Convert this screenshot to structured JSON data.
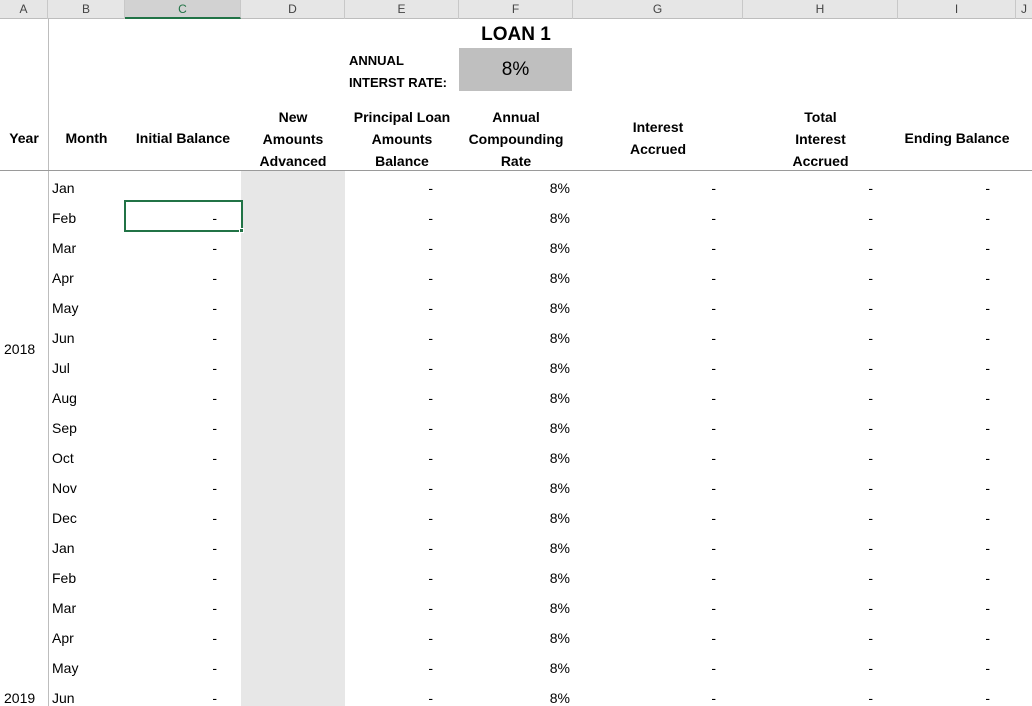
{
  "columns": [
    "A",
    "B",
    "C",
    "D",
    "E",
    "F",
    "G",
    "H",
    "I",
    "J"
  ],
  "selected_column": "C",
  "loan_title": "LOAN 1",
  "rate_label_line1": "ANNUAL",
  "rate_label_line2": "INTERST RATE:",
  "annual_rate": "8%",
  "headers": {
    "year": "Year",
    "month": "Month",
    "initial_balance": "Initial Balance",
    "new_amounts": [
      "New",
      "Amounts",
      "Advanced"
    ],
    "principal": [
      "Principal Loan",
      "Amounts",
      "Balance"
    ],
    "compounding": [
      "Annual",
      "Compounding",
      "Rate"
    ],
    "interest": [
      "Interest",
      "Accrued"
    ],
    "total_interest": [
      "Total",
      "Interest",
      "Accrued"
    ],
    "ending_balance": "Ending Balance"
  },
  "years": [
    "2018",
    "2019"
  ],
  "rows": [
    {
      "month": "Jan",
      "initial": "",
      "principal": "-",
      "rate": "8%",
      "interest": "-",
      "total": "-",
      "ending": "-"
    },
    {
      "month": "Feb",
      "initial": "-",
      "principal": "-",
      "rate": "8%",
      "interest": "-",
      "total": "-",
      "ending": "-"
    },
    {
      "month": "Mar",
      "initial": "-",
      "principal": "-",
      "rate": "8%",
      "interest": "-",
      "total": "-",
      "ending": "-"
    },
    {
      "month": "Apr",
      "initial": "-",
      "principal": "-",
      "rate": "8%",
      "interest": "-",
      "total": "-",
      "ending": "-"
    },
    {
      "month": "May",
      "initial": "-",
      "principal": "-",
      "rate": "8%",
      "interest": "-",
      "total": "-",
      "ending": "-"
    },
    {
      "month": "Jun",
      "initial": "-",
      "principal": "-",
      "rate": "8%",
      "interest": "-",
      "total": "-",
      "ending": "-"
    },
    {
      "month": "Jul",
      "initial": "-",
      "principal": "-",
      "rate": "8%",
      "interest": "-",
      "total": "-",
      "ending": "-"
    },
    {
      "month": "Aug",
      "initial": "-",
      "principal": "-",
      "rate": "8%",
      "interest": "-",
      "total": "-",
      "ending": "-"
    },
    {
      "month": "Sep",
      "initial": "-",
      "principal": "-",
      "rate": "8%",
      "interest": "-",
      "total": "-",
      "ending": "-"
    },
    {
      "month": "Oct",
      "initial": "-",
      "principal": "-",
      "rate": "8%",
      "interest": "-",
      "total": "-",
      "ending": "-"
    },
    {
      "month": "Nov",
      "initial": "-",
      "principal": "-",
      "rate": "8%",
      "interest": "-",
      "total": "-",
      "ending": "-"
    },
    {
      "month": "Dec",
      "initial": "-",
      "principal": "-",
      "rate": "8%",
      "interest": "-",
      "total": "-",
      "ending": "-"
    },
    {
      "month": "Jan",
      "initial": "-",
      "principal": "-",
      "rate": "8%",
      "interest": "-",
      "total": "-",
      "ending": "-"
    },
    {
      "month": "Feb",
      "initial": "-",
      "principal": "-",
      "rate": "8%",
      "interest": "-",
      "total": "-",
      "ending": "-"
    },
    {
      "month": "Mar",
      "initial": "-",
      "principal": "-",
      "rate": "8%",
      "interest": "-",
      "total": "-",
      "ending": "-"
    },
    {
      "month": "Apr",
      "initial": "-",
      "principal": "-",
      "rate": "8%",
      "interest": "-",
      "total": "-",
      "ending": "-"
    },
    {
      "month": "May",
      "initial": "-",
      "principal": "-",
      "rate": "8%",
      "interest": "-",
      "total": "-",
      "ending": "-"
    },
    {
      "month": "Jun",
      "initial": "-",
      "principal": "-",
      "rate": "8%",
      "interest": "-",
      "total": "-",
      "ending": "-"
    }
  ],
  "colors": {
    "selection": "#217346",
    "rate_box": "#bfbfbf",
    "shaded_column": "#e7e7e7"
  }
}
